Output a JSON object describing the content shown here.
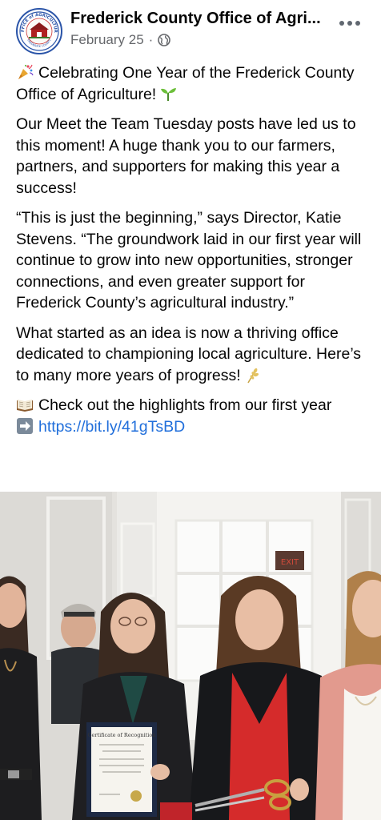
{
  "post": {
    "page_name": "Frederick County Office of Agri...",
    "date": "February 25",
    "date_separator": "·",
    "paragraphs": {
      "p1": "Celebrating One Year of the Frederick County Office of Agriculture!",
      "p2": "Our Meet the Team Tuesday posts have led us to this moment! A huge thank you to our farmers, partners, and supporters for making this year a success!",
      "p3": "“This is just the beginning,” says Director, Katie Stevens. “The groundwork laid in our first year will continue to grow into new opportunities, stronger connections, and even greater support for Frederick County’s agricultural industry.”",
      "p4": "What started as an idea is now a thriving office dedicated to championing local agriculture. Here’s to many more years of progress!",
      "p5": "Check out the highlights from our first year"
    },
    "link": "https://bit.ly/41gTsBD"
  },
  "logo": {
    "top_text": "OFFICE of AGRICULTURE",
    "bottom_text": "FREDERICK COUNTY"
  },
  "photo": {
    "certificate_title": "Certificate of Recognition",
    "exit_sign": "EXIT"
  },
  "icons": {
    "privacy": "globe-icon",
    "more": "more-horizontal-icon",
    "celebrate": "party-popper-icon",
    "seedling": "seedling-icon",
    "wheat": "wheat-icon",
    "book": "open-book-icon",
    "arrow": "right-arrow-icon"
  },
  "colors": {
    "link": "#216fdb",
    "meta": "#65676b",
    "text": "#050505"
  }
}
